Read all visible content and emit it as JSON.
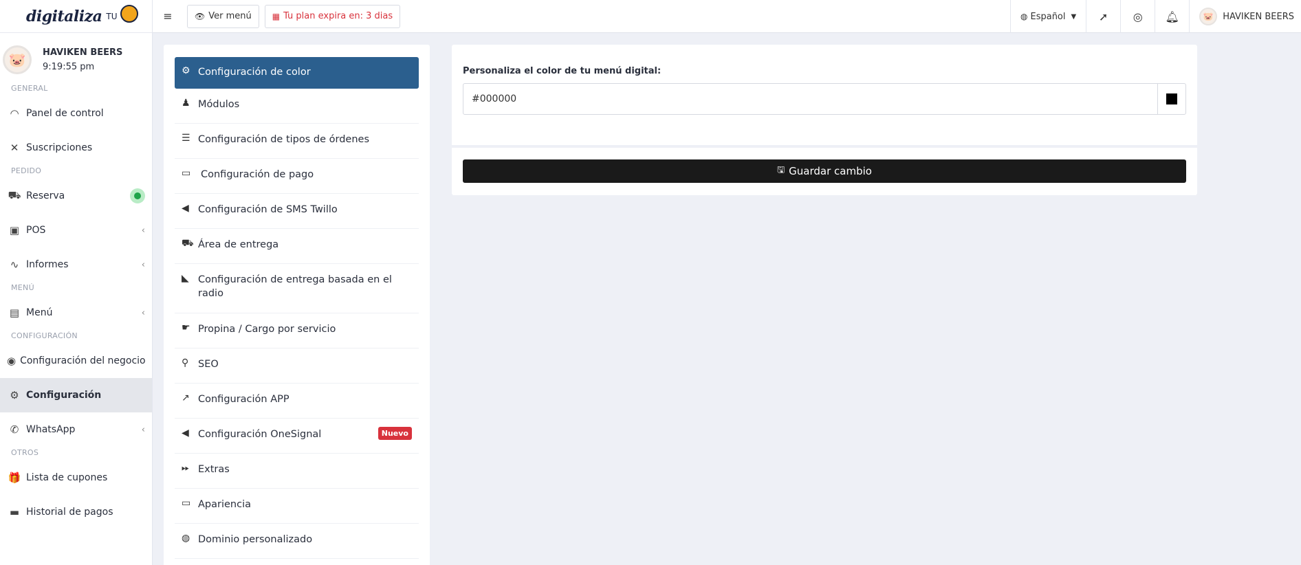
{
  "brand": {
    "logo_text": "digitaliza",
    "logo_small": "TU"
  },
  "user": {
    "name": "HAVIKEN BEERS",
    "time": "9:19:55 pm"
  },
  "sidebar": {
    "sections": {
      "general": "GENERAL",
      "pedido": "PEDIDO",
      "menu": "MENÚ",
      "configuracion": "CONFIGURACIÓN",
      "otros": "OTROS"
    },
    "items": {
      "panel": "Panel de control",
      "suscripciones": "Suscripciones",
      "reserva": "Reserva",
      "pos": "POS",
      "informes": "Informes",
      "menu": "Menú",
      "negocio": "Configuración del negocio",
      "configuracion": "Configuración",
      "whatsapp": "WhatsApp",
      "cupones": "Lista de cupones",
      "pagos": "Historial de pagos"
    }
  },
  "topbar": {
    "ver_menu": "Ver menú",
    "plan_expira": "Tu plan expira en: 3 dias",
    "language": "Español",
    "user_name": "HAVIKEN BEERS"
  },
  "settings_menu": [
    {
      "label": "Configuración de color",
      "icon": "gear-icon"
    },
    {
      "label": "Módulos",
      "icon": "award-icon"
    },
    {
      "label": "Configuración de tipos de órdenes",
      "icon": "list-icon"
    },
    {
      "label": "Configuración de pago",
      "icon": "card-icon"
    },
    {
      "label": "Configuración de SMS Twillo",
      "icon": "megaphone-icon"
    },
    {
      "label": "Área de entrega",
      "icon": "truck-icon"
    },
    {
      "label": "Configuración de entrega basada en el radio",
      "icon": "motorcycle-icon"
    },
    {
      "label": "Propina / Cargo por servicio",
      "icon": "hand-icon"
    },
    {
      "label": "SEO",
      "icon": "search-icon"
    },
    {
      "label": "Configuración APP",
      "icon": "share-icon"
    },
    {
      "label": "Configuración OneSignal",
      "icon": "bullhorn-icon",
      "badge": "Nuevo"
    },
    {
      "label": "Extras",
      "icon": "forward-icon"
    },
    {
      "label": "Apariencia",
      "icon": "monitor-icon"
    },
    {
      "label": "Dominio personalizado",
      "icon": "globe-icon"
    }
  ],
  "content": {
    "field_label": "Personaliza el color de tu menú digital:",
    "color_value": "#000000",
    "swatch_color": "#000000",
    "save_label": "Guardar cambio"
  },
  "colors": {
    "active_menu": "#2b5f8e",
    "plan_warning": "#d8323c",
    "badge_new": "#d8323c",
    "status_dot": "#1fa34a"
  }
}
